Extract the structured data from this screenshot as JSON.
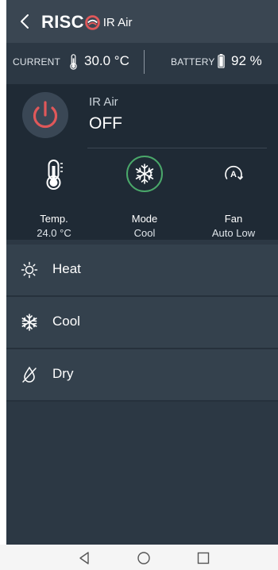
{
  "header": {
    "logo_text": "RISC",
    "title": "IR Air"
  },
  "status": {
    "current_label": "CURRENT",
    "current_value": "30.0 °C",
    "battery_label": "BATTERY",
    "battery_value": "92 %"
  },
  "device": {
    "name": "IR Air",
    "state": "OFF"
  },
  "controls": [
    {
      "label": "Temp.",
      "value": "24.0 °C",
      "icon": "thermometer-icon"
    },
    {
      "label": "Mode",
      "value": "Cool",
      "icon": "snowflake-sun-icon"
    },
    {
      "label": "Fan",
      "value": "Auto Low",
      "icon": "fan-auto-icon"
    }
  ],
  "modes": [
    {
      "label": "Heat",
      "icon": "sun-icon"
    },
    {
      "label": "Cool",
      "icon": "snowflake-icon"
    },
    {
      "label": "Dry",
      "icon": "dry-icon"
    }
  ],
  "colors": {
    "power": "#e0585a",
    "mode_ring": "#4aa86a",
    "background": "#2c3844",
    "card": "#1f2a35"
  }
}
